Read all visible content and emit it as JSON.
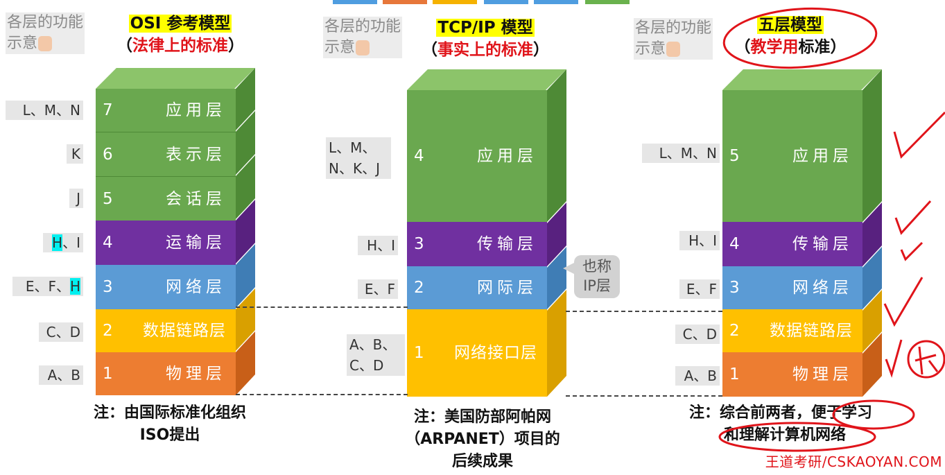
{
  "top_strip_colors": [
    "#4f9de0",
    "#e7773a",
    "#f5b200",
    "#4f9de0",
    "#4f9de0",
    "#6ab24d"
  ],
  "colors": {
    "application": "#6aa84f",
    "application_side": "#4e8a36",
    "presentation": "#6aa84f",
    "session": "#6aa84f",
    "transport": "#7030a0",
    "transport_side": "#58217f",
    "network": "#5b9bd5",
    "network_side": "#3f7db5",
    "datalink": "#ffc000",
    "datalink_side": "#d9a000",
    "physical": "#ed7d31",
    "physical_side": "#c85f18",
    "top_face": "#8cc46a",
    "annotation_red": "#e0141a",
    "highlight_yellow": "#ffff00",
    "highlight_cyan": "#00f0f0"
  },
  "hints": [
    "各层的功能示意",
    "各层的功能示意",
    "各层的功能示意"
  ],
  "osi": {
    "title": "OSI 参考模型",
    "subtitle_open": "（",
    "subtitle_red": "法律上的标准",
    "subtitle_close": "）",
    "layers": [
      {
        "num": "7",
        "name": "应用层",
        "label": "L、M、N"
      },
      {
        "num": "6",
        "name": "表示层",
        "label": "K"
      },
      {
        "num": "5",
        "name": "会话层",
        "label": "J"
      },
      {
        "num": "4",
        "name": "运输层",
        "label_hl": "H",
        "label_rest": "、I"
      },
      {
        "num": "3",
        "name": "网络层",
        "label": "E、F、",
        "label_hl": "H"
      },
      {
        "num": "2",
        "name": "数据链路层",
        "label": "C、D"
      },
      {
        "num": "1",
        "name": "物理层",
        "label": "A、B"
      }
    ],
    "note_line1": "注：由国际标准化组织",
    "note_line2": "ISO提出"
  },
  "tcpip": {
    "title": "TCP/IP 模型",
    "subtitle_open": "（",
    "subtitle_red": "事实上的标准",
    "subtitle_close": "）",
    "layers": [
      {
        "num": "4",
        "name": "应用层",
        "label_line1": "L、M、",
        "label_line2": "N、K、J"
      },
      {
        "num": "3",
        "name": "传输层",
        "label": "H、I"
      },
      {
        "num": "2",
        "name": "网际层",
        "label": "E、F"
      },
      {
        "num": "1",
        "name": "网络接口层",
        "label_line1": "A、B、",
        "label_line2": "C、D"
      }
    ],
    "callout_line1": "也称",
    "callout_line2": "IP层",
    "note_line1": "注：美国防部阿帕网",
    "note_line2": "（ARPANET）项目的",
    "note_line3": "后续成果"
  },
  "five": {
    "title": "五层模型",
    "subtitle_open": "（",
    "subtitle_red": "教学用",
    "subtitle_rest": "标准",
    "subtitle_close": "）",
    "layers": [
      {
        "num": "5",
        "name": "应用层",
        "label": "L、M、N"
      },
      {
        "num": "4",
        "name": "传输层",
        "label": "H、I"
      },
      {
        "num": "3",
        "name": "网络层",
        "label": "E、F"
      },
      {
        "num": "2",
        "name": "数据链路层",
        "label": "C、D"
      },
      {
        "num": "1",
        "name": "物理层",
        "label": "A、B"
      }
    ],
    "note_line1": "注：综合前两者，便于学习",
    "note_line2": "和理解计算机网络"
  },
  "watermark": "王道考研/CSKAOYAN.COM"
}
